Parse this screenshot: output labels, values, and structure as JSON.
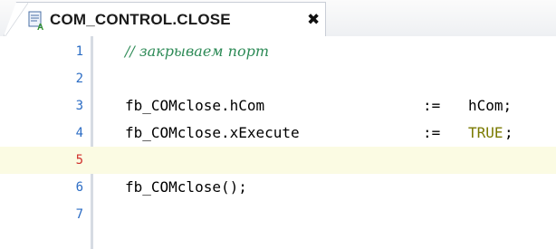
{
  "tab": {
    "title": "COM_CONTROL.CLOSE",
    "close_glyph": "✖",
    "icon": "st-program-icon"
  },
  "editor": {
    "current_line": 5,
    "lines": [
      {
        "number": "1",
        "comment": "// закрываем порт"
      },
      {
        "number": "2"
      },
      {
        "number": "3",
        "lhs": "fb_COMclose.hCom",
        "op": ":=",
        "rhs": "hCom;"
      },
      {
        "number": "4",
        "lhs": "fb_COMclose.xExecute",
        "op": ":=",
        "rhs_literal": "TRUE",
        "rhs_tail": ";"
      },
      {
        "number": "5"
      },
      {
        "number": "6",
        "call": "fb_COMclose();"
      },
      {
        "number": "7"
      }
    ]
  },
  "colors": {
    "line_number": "#2b6cc4",
    "current_line_number": "#d0312d",
    "comment": "#2e8b57",
    "literal": "#7a7a00",
    "active_line_bg": "#fbfbe3"
  }
}
